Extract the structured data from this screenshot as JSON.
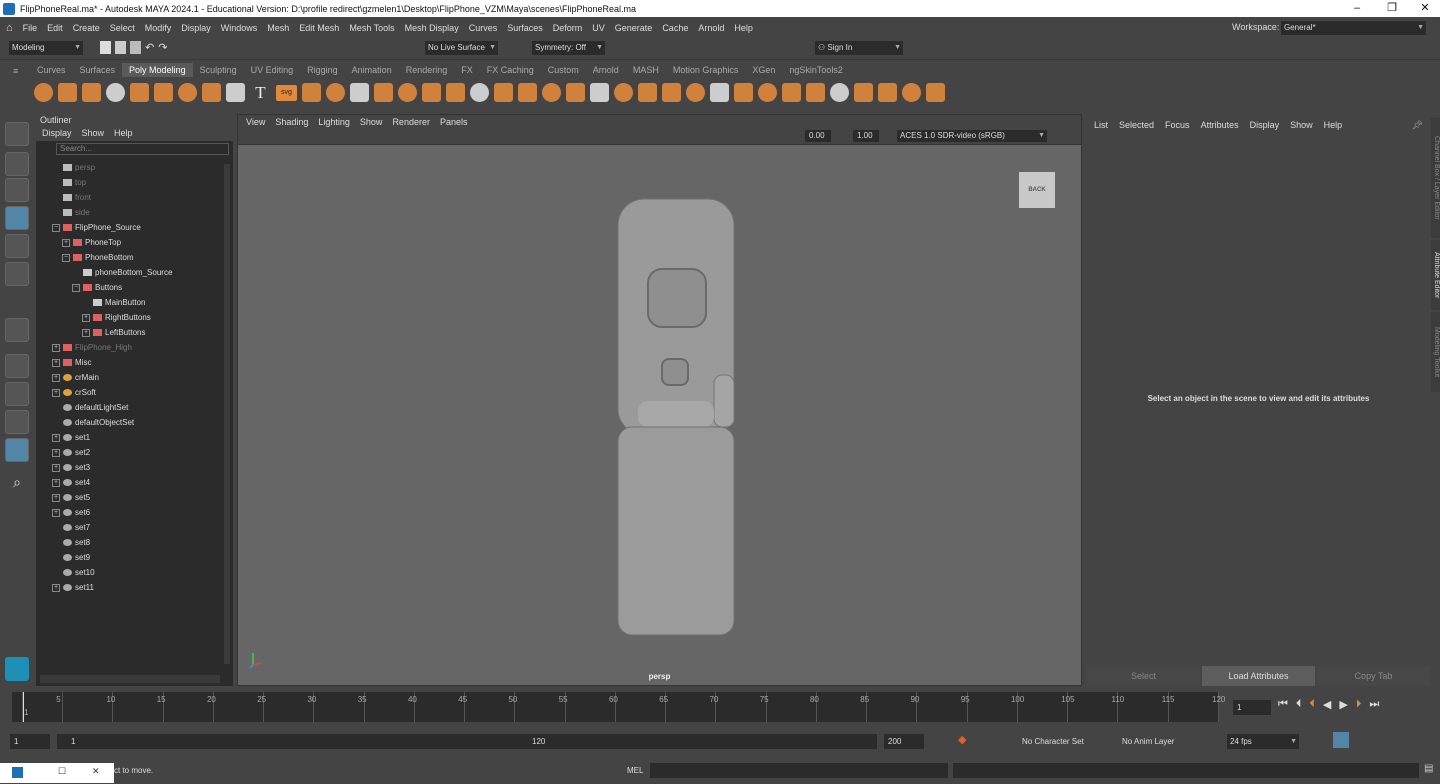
{
  "window": {
    "title": "FlipPhoneReal.ma* - Autodesk MAYA 2024.1 - Educational Version: D:\\profile redirect\\gzmelen1\\Desktop\\FlipPhone_VZM\\Maya\\scenes\\FlipPhoneReal.ma",
    "min": "–",
    "max": "❐",
    "close": "✕"
  },
  "menubar": {
    "items": [
      "File",
      "Edit",
      "Create",
      "Select",
      "Modify",
      "Display",
      "Windows",
      "Mesh",
      "Edit Mesh",
      "Mesh Tools",
      "Mesh Display",
      "Curves",
      "Surfaces",
      "Deform",
      "UV",
      "Generate",
      "Cache",
      "Arnold",
      "Help"
    ],
    "workspace_label": "Workspace:",
    "workspace_value": "General*"
  },
  "statusline": {
    "mode": "Modeling",
    "live_surface": "No Live Surface",
    "symmetry": "Symmetry: Off",
    "sign_in": "Sign In"
  },
  "shelf": {
    "tabs": [
      "Curves",
      "Surfaces",
      "Poly Modeling",
      "Sculpting",
      "UV Editing",
      "Rigging",
      "Animation",
      "Rendering",
      "FX",
      "FX Caching",
      "Custom",
      "Arnold",
      "MASH",
      "Motion Graphics",
      "XGen",
      "ngSkinTools2"
    ],
    "active_tab": "Poly Modeling",
    "svg_label": "svg",
    "text_tool": "T"
  },
  "outliner": {
    "title": "Outliner",
    "menu": [
      "Display",
      "Show",
      "Help"
    ],
    "search_placeholder": "Search...",
    "items": [
      {
        "label": "persp",
        "dim": true,
        "indent": 0,
        "icon": "camera"
      },
      {
        "label": "top",
        "dim": true,
        "indent": 0,
        "icon": "camera"
      },
      {
        "label": "front",
        "dim": true,
        "indent": 0,
        "icon": "camera"
      },
      {
        "label": "side",
        "dim": true,
        "indent": 0,
        "icon": "camera"
      },
      {
        "label": "FlipPhone_Source",
        "dim": false,
        "indent": 0,
        "icon": "group",
        "exp": "−"
      },
      {
        "label": "PhoneTop",
        "dim": false,
        "indent": 1,
        "icon": "group",
        "exp": "+"
      },
      {
        "label": "PhoneBottom",
        "dim": false,
        "indent": 1,
        "icon": "group",
        "exp": "−"
      },
      {
        "label": "phoneBottom_Source",
        "dim": false,
        "indent": 2,
        "icon": "mesh"
      },
      {
        "label": "Buttons",
        "dim": false,
        "indent": 2,
        "icon": "group",
        "exp": "−"
      },
      {
        "label": "MainButton",
        "dim": false,
        "indent": 3,
        "icon": "mesh"
      },
      {
        "label": "RightButtons",
        "dim": false,
        "indent": 3,
        "icon": "group",
        "exp": "+"
      },
      {
        "label": "LeftButtons",
        "dim": false,
        "indent": 3,
        "icon": "group",
        "exp": "+"
      },
      {
        "label": "FlipPhone_High",
        "dim": true,
        "indent": 0,
        "icon": "group",
        "exp": "+"
      },
      {
        "label": "Misc",
        "dim": false,
        "indent": 0,
        "icon": "group",
        "exp": "+"
      },
      {
        "label": "crMain",
        "dim": false,
        "indent": 0,
        "icon": "ref",
        "exp": "+"
      },
      {
        "label": "crSoft",
        "dim": false,
        "indent": 0,
        "icon": "ref",
        "exp": "+"
      },
      {
        "label": "defaultLightSet",
        "dim": false,
        "indent": 0,
        "icon": "set"
      },
      {
        "label": "defaultObjectSet",
        "dim": false,
        "indent": 0,
        "icon": "set"
      },
      {
        "label": "set1",
        "dim": false,
        "indent": 0,
        "icon": "set",
        "exp": "+"
      },
      {
        "label": "set2",
        "dim": false,
        "indent": 0,
        "icon": "set",
        "exp": "+"
      },
      {
        "label": "set3",
        "dim": false,
        "indent": 0,
        "icon": "set",
        "exp": "+"
      },
      {
        "label": "set4",
        "dim": false,
        "indent": 0,
        "icon": "set",
        "exp": "+"
      },
      {
        "label": "set5",
        "dim": false,
        "indent": 0,
        "icon": "set",
        "exp": "+"
      },
      {
        "label": "set6",
        "dim": false,
        "indent": 0,
        "icon": "set",
        "exp": "+"
      },
      {
        "label": "set7",
        "dim": false,
        "indent": 0,
        "icon": "set"
      },
      {
        "label": "set8",
        "dim": false,
        "indent": 0,
        "icon": "set"
      },
      {
        "label": "set9",
        "dim": false,
        "indent": 0,
        "icon": "set"
      },
      {
        "label": "set10",
        "dim": false,
        "indent": 0,
        "icon": "set"
      },
      {
        "label": "set11",
        "dim": false,
        "indent": 0,
        "icon": "set",
        "exp": "+"
      }
    ]
  },
  "viewport": {
    "menu": [
      "View",
      "Shading",
      "Lighting",
      "Show",
      "Renderer",
      "Panels"
    ],
    "exposure": "0.00",
    "gamma": "1.00",
    "colorspace": "ACES 1.0 SDR-video (sRGB)",
    "camera_label": "persp",
    "viewcube_label": "BACK"
  },
  "attribute_editor": {
    "menu": [
      "List",
      "Selected",
      "Focus",
      "Attributes",
      "Display",
      "Show",
      "Help"
    ],
    "message": "Select an object in the scene to view and edit its attributes",
    "buttons": [
      "Select",
      "Load Attributes",
      "Copy Tab"
    ],
    "side_tabs": [
      "Channel Box / Layer Editor",
      "Attribute Editor",
      "Modeling Toolkit"
    ]
  },
  "timeline": {
    "ticks": [
      "1",
      "5",
      "10",
      "15",
      "20",
      "25",
      "30",
      "35",
      "40",
      "45",
      "50",
      "55",
      "60",
      "65",
      "70",
      "75",
      "80",
      "85",
      "90",
      "95",
      "100",
      "105",
      "110",
      "115",
      "120"
    ],
    "current_frame": "1"
  },
  "range": {
    "start": "1",
    "inner_start": "1",
    "inner_end": "120",
    "end": "200",
    "character_set": "No Character Set",
    "anim_layer": "No Anim Layer",
    "fps": "24 fps"
  },
  "commandline": {
    "help_text": "ct to move.",
    "mel_label": "MEL"
  },
  "colors": {
    "accent": "#5285a6",
    "shelf_orange": "#e08a3c",
    "mesh": "#9a9a9a"
  }
}
